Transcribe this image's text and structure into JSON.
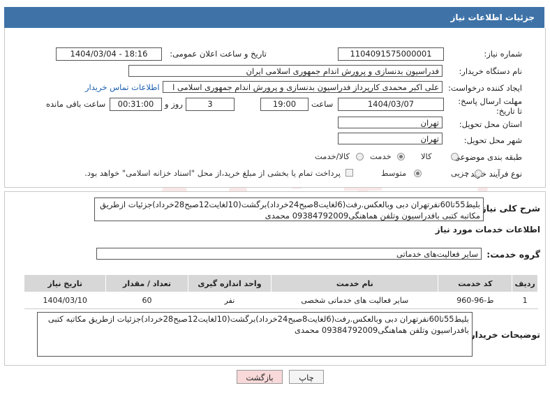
{
  "title": "جزئیات اطلاعات نیاز",
  "fields": {
    "need_number_label": "شماره نیاز:",
    "need_number": "1104091575000001",
    "announce_label": "تاریخ و ساعت اعلان عمومی:",
    "announce_value": "1404/03/04 - 18:16",
    "buyer_org_label": "نام دستگاه خریدار:",
    "buyer_org": "فدراسیون بدنسازی و پرورش اندام جمهوری اسلامی ایران",
    "requester_label": "ایجاد کننده درخواست:",
    "requester": "علی اکبر محمدی کارپرداز فدراسیون بدنسازی و پرورش اندام جمهوری اسلامی ا",
    "contact_link": "اطلاعات تماس خریدار",
    "deadline_label": "مهلت ارسال پاسخ: تا تاریخ:",
    "deadline_date": "1404/03/07",
    "time_label": "ساعت",
    "deadline_time": "19:00",
    "days_value": "3",
    "days_label": "روز و",
    "remaining_time": "00:31:00",
    "remaining_label": "ساعت باقی مانده",
    "province_label": "استان محل تحویل:",
    "province": "تهران",
    "city_label": "شهر محل تحویل:",
    "city": "تهران",
    "category_label": "طبقه بندی موضوعی:",
    "category_options": [
      "کالا",
      "خدمت",
      "کالا/خدمت"
    ],
    "process_label": "نوع فرآیند خرید :",
    "process_options": [
      "جزیی",
      "متوسط"
    ],
    "payment_note": "پرداخت تمام یا بخشی از مبلغ خرید،از محل \"اسناد خزانه اسلامی\" خواهد بود."
  },
  "summary": {
    "label": "شرح کلی نیاز:",
    "text": "بلیط55تا60نفرتهران دبی وبالعکس.رفت(6لغایت8صبح24خرداد)برگشت(10لغایت12صبح28خرداد)جزئیات ازطریق مکاتبه کتبی بافدراسیون وتلفن هماهنگی09384792009 محمدی"
  },
  "services": {
    "heading": "اطلاعات خدمات مورد نیاز",
    "group_label": "گروه خدمت:",
    "group_value": "سایر فعالیت‌های خدماتی",
    "columns": [
      "ردیف",
      "کد خدمت",
      "نام خدمت",
      "واحد اندازه گیری",
      "تعداد / مقدار",
      "تاریخ نیاز"
    ],
    "rows": [
      {
        "idx": "1",
        "code": "ط-96-960",
        "name": "سایر فعالیت های خدماتی شخصی",
        "unit": "نفر",
        "qty": "60",
        "date": "1404/03/10"
      }
    ]
  },
  "buyer_notes": {
    "label": "توضیحات خریدار:",
    "text": "بلیط55تا60نفرتهران دبی وبالعکس.رفت(6لغایت8صبح24خرداد)برگشت(10لغایت12صبح28خرداد)جزئیات ازطریق مکاتبه کتبی بافدراسیون وتلفن هماهنگی09384792009 محمدی"
  },
  "buttons": {
    "print": "چاپ",
    "back": "بازگشت"
  },
  "watermark": "AriaTender.neT",
  "colors": {
    "title_bg": "#3f73a8",
    "back_btn_bg": "#f8d8d8",
    "watermark": "#d04040"
  }
}
